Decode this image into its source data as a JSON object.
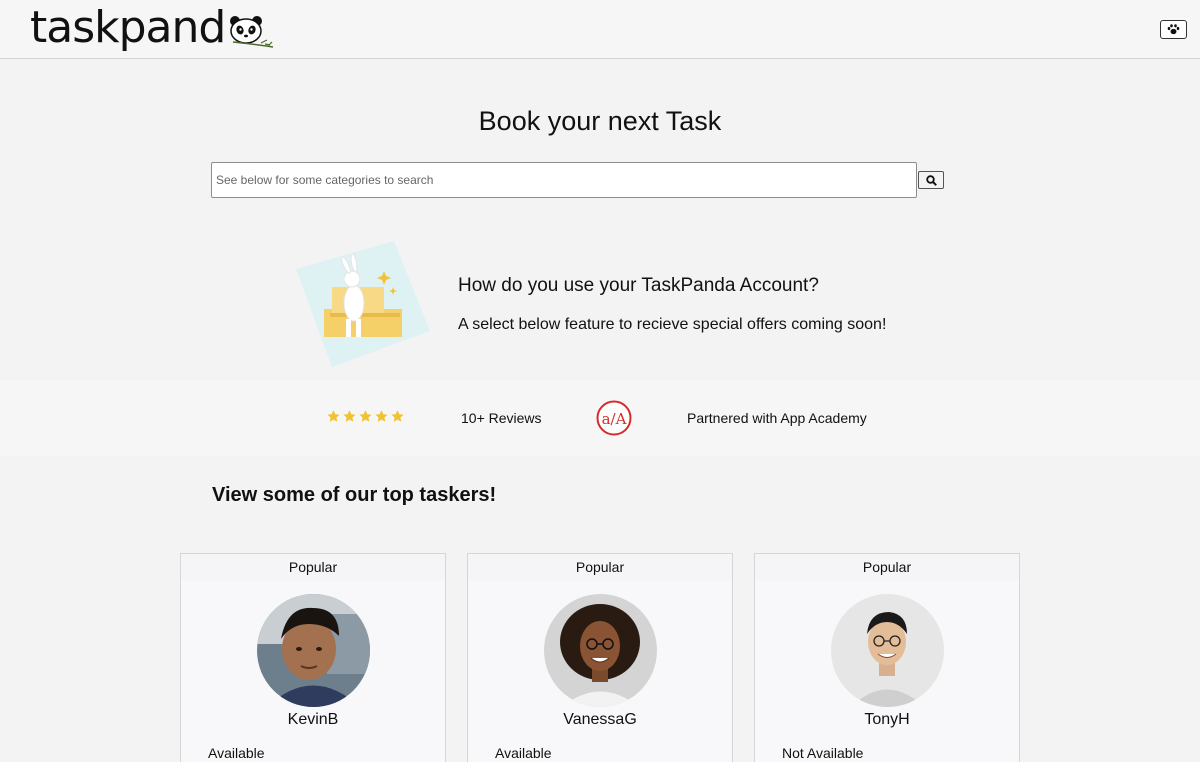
{
  "header": {
    "logo_text": "taskpand",
    "menu_icon": "paw-icon"
  },
  "hero": {
    "title": "Book your next Task",
    "search_placeholder": "See below for some categories to search",
    "search_icon": "search-icon"
  },
  "promo": {
    "heading": "How do you use your TaskPanda Account?",
    "subtext": "A select below feature to recieve special offers coming soon!"
  },
  "trust": {
    "rating": 5,
    "rating_max": 5,
    "reviews": "10+ Reviews",
    "partner_logo_text": "a/A",
    "partner": "Partnered with App Academy"
  },
  "section": {
    "heading": "View some of our top taskers!"
  },
  "taskers": [
    {
      "tag": "Popular",
      "name": "KevinB",
      "status": "Available"
    },
    {
      "tag": "Popular",
      "name": "VanessaG",
      "status": "Available"
    },
    {
      "tag": "Popular",
      "name": "TonyH",
      "status": "Not Available"
    }
  ],
  "colors": {
    "star": "#f1c232",
    "partner_red": "#d62b2b",
    "page_bg": "#f3f3f4"
  }
}
